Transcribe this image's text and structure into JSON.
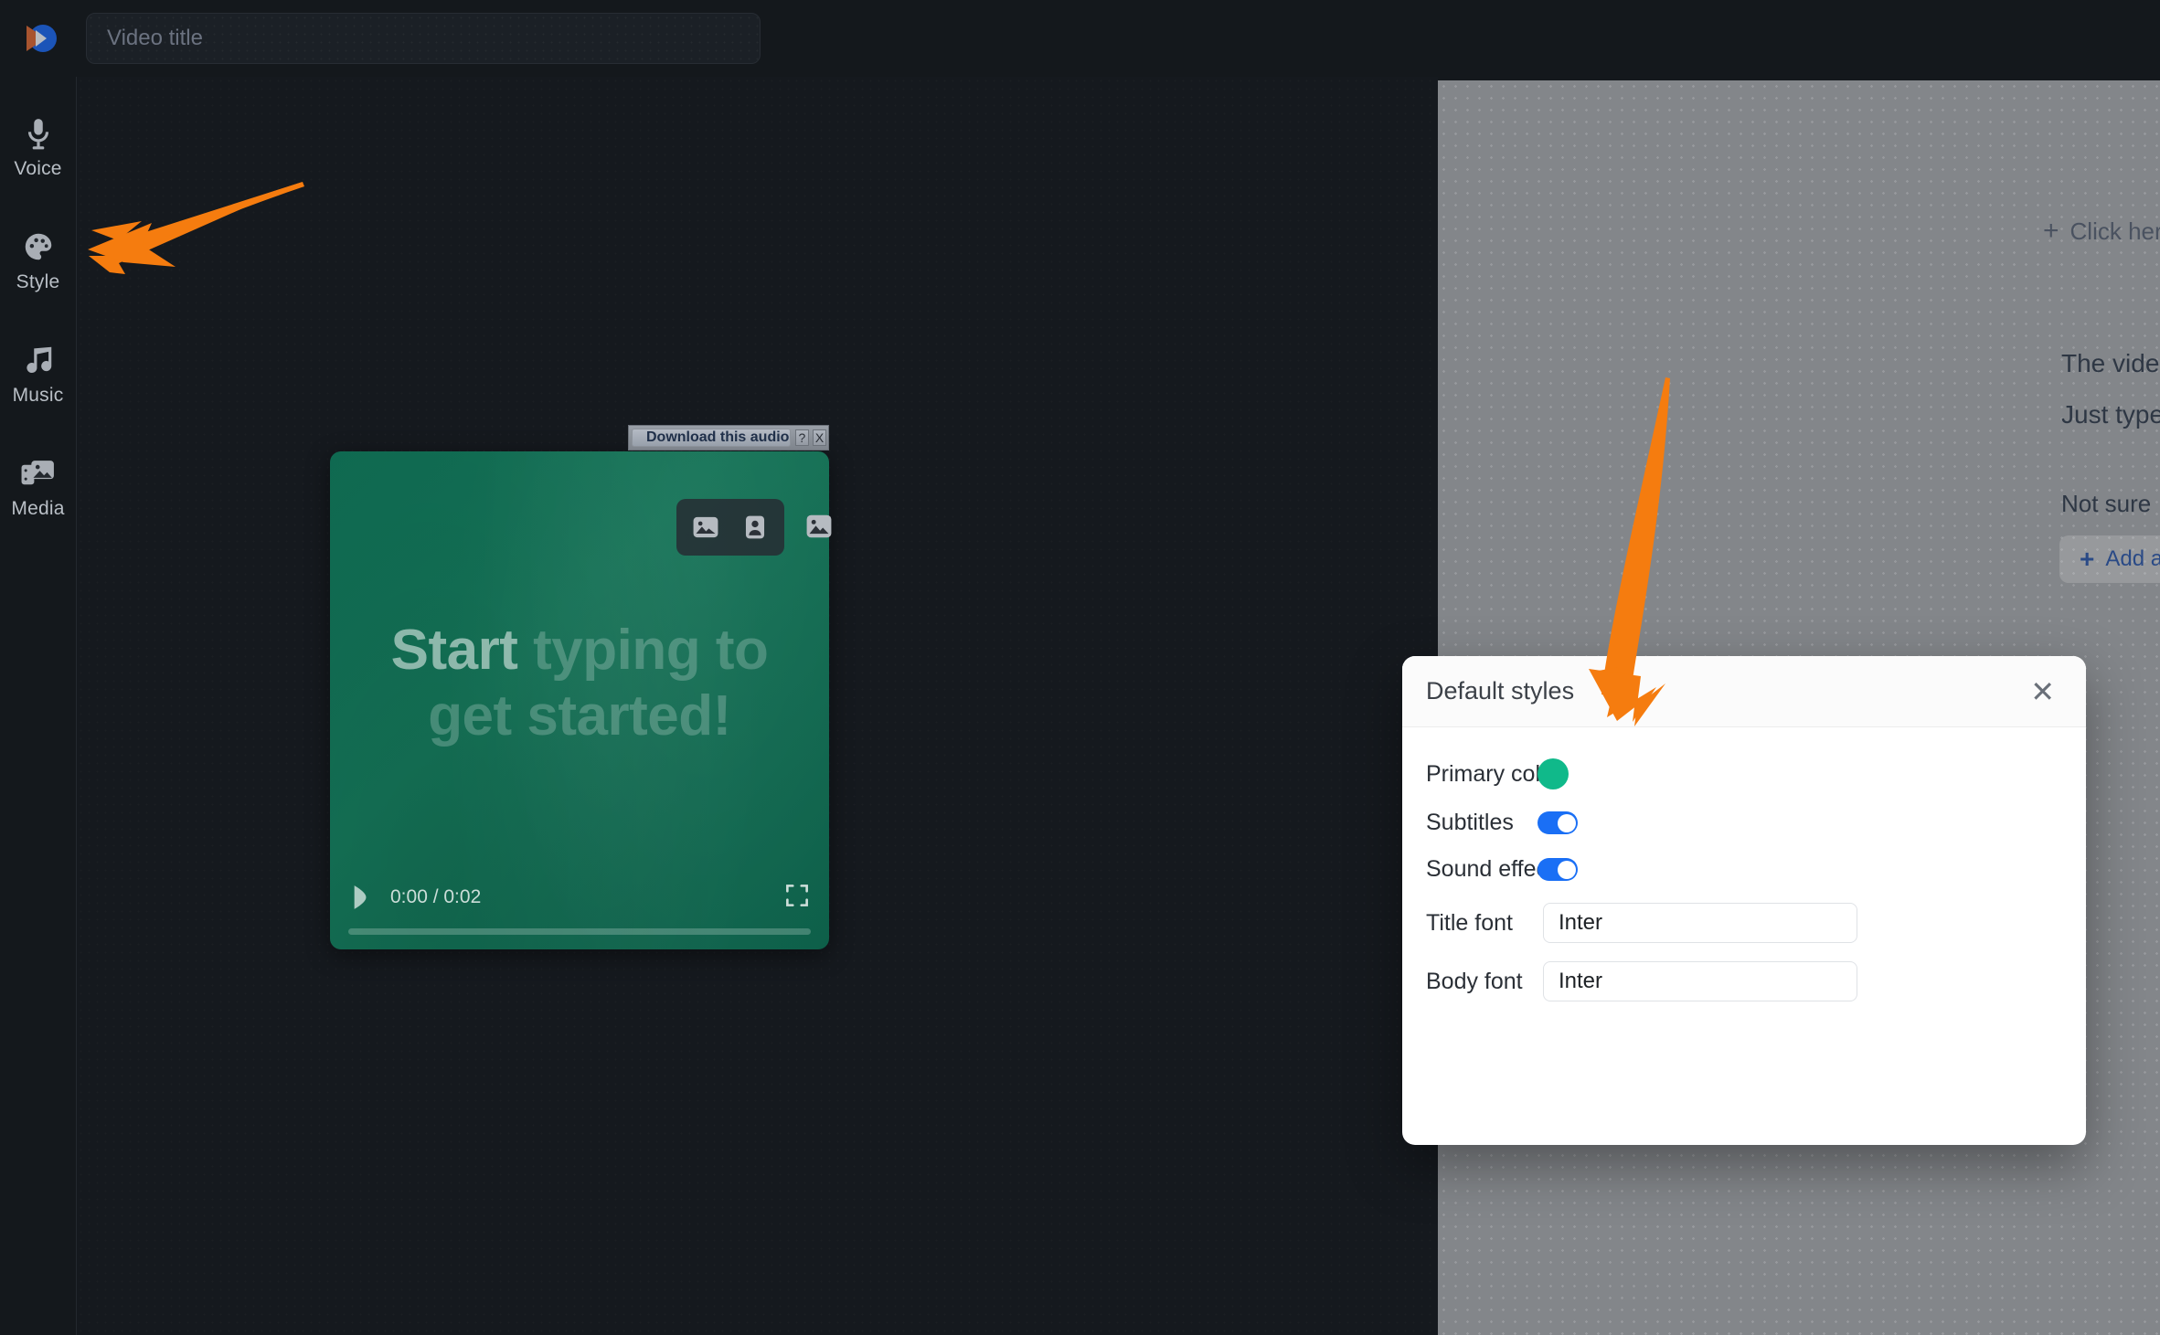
{
  "app": {
    "logo_icon": "play-logo-icon",
    "accent_color": "#f57c0f",
    "title_bar": {
      "input_value": "",
      "input_placeholder": "Video title"
    }
  },
  "sidebar": {
    "items": [
      {
        "label": "Voice",
        "icon": "microphone-icon"
      },
      {
        "label": "Style",
        "icon": "palette-icon"
      },
      {
        "label": "Music",
        "icon": "music-note-icon"
      },
      {
        "label": "Media",
        "icon": "media-images-icon"
      }
    ]
  },
  "player_toolbar": {
    "buttons": [
      {
        "icon": "image-icon",
        "name": "insert-image-button"
      },
      {
        "icon": "person-icon",
        "name": "insert-avatar-button"
      }
    ],
    "extra_button": {
      "icon": "image-icon",
      "name": "insert-image-alt-button"
    }
  },
  "download_widget": {
    "label": "Download this audio",
    "play_icon": "play-triangle-icon",
    "help_label": "?",
    "close_label": "X"
  },
  "player": {
    "placeholder_highlight": "Start",
    "placeholder_rest": " typing to get started!",
    "current_time": "0:00",
    "duration": "0:02",
    "time_display": "0:00 / 0:02",
    "play_icon": "play-icon",
    "fullscreen_icon": "fullscreen-icon",
    "progress_percent": 0,
    "canvas_color": "#0f6b52"
  },
  "right_panel": {
    "click_here": "Click her",
    "plus_icon": "plus-icon",
    "line1": "The vide",
    "line2": "Just type",
    "line3": "Not sure",
    "add_button": "Add a"
  },
  "modal": {
    "title": "Default styles",
    "close_icon": "close-icon",
    "rows": [
      {
        "label": "Primary color",
        "type": "color",
        "value": "#10b98a",
        "name": "primary-color-swatch"
      },
      {
        "label": "Subtitles",
        "type": "toggle",
        "value": "on",
        "color": "#1a6ff5",
        "name": "subtitles-toggle"
      },
      {
        "label": "Sound effects",
        "type": "toggle",
        "value": "on",
        "color": "#1a6ff5",
        "name": "sound-effects-toggle"
      },
      {
        "label": "Title font",
        "type": "text",
        "value": "Inter",
        "name": "title-font-input"
      },
      {
        "label": "Body font",
        "type": "text",
        "value": "Inter",
        "name": "body-font-input"
      }
    ]
  },
  "annotations": {
    "arrow_color": "#f57c0f",
    "arrow1_target": "sidebar-item-style",
    "arrow2_target": "default-styles-modal"
  }
}
